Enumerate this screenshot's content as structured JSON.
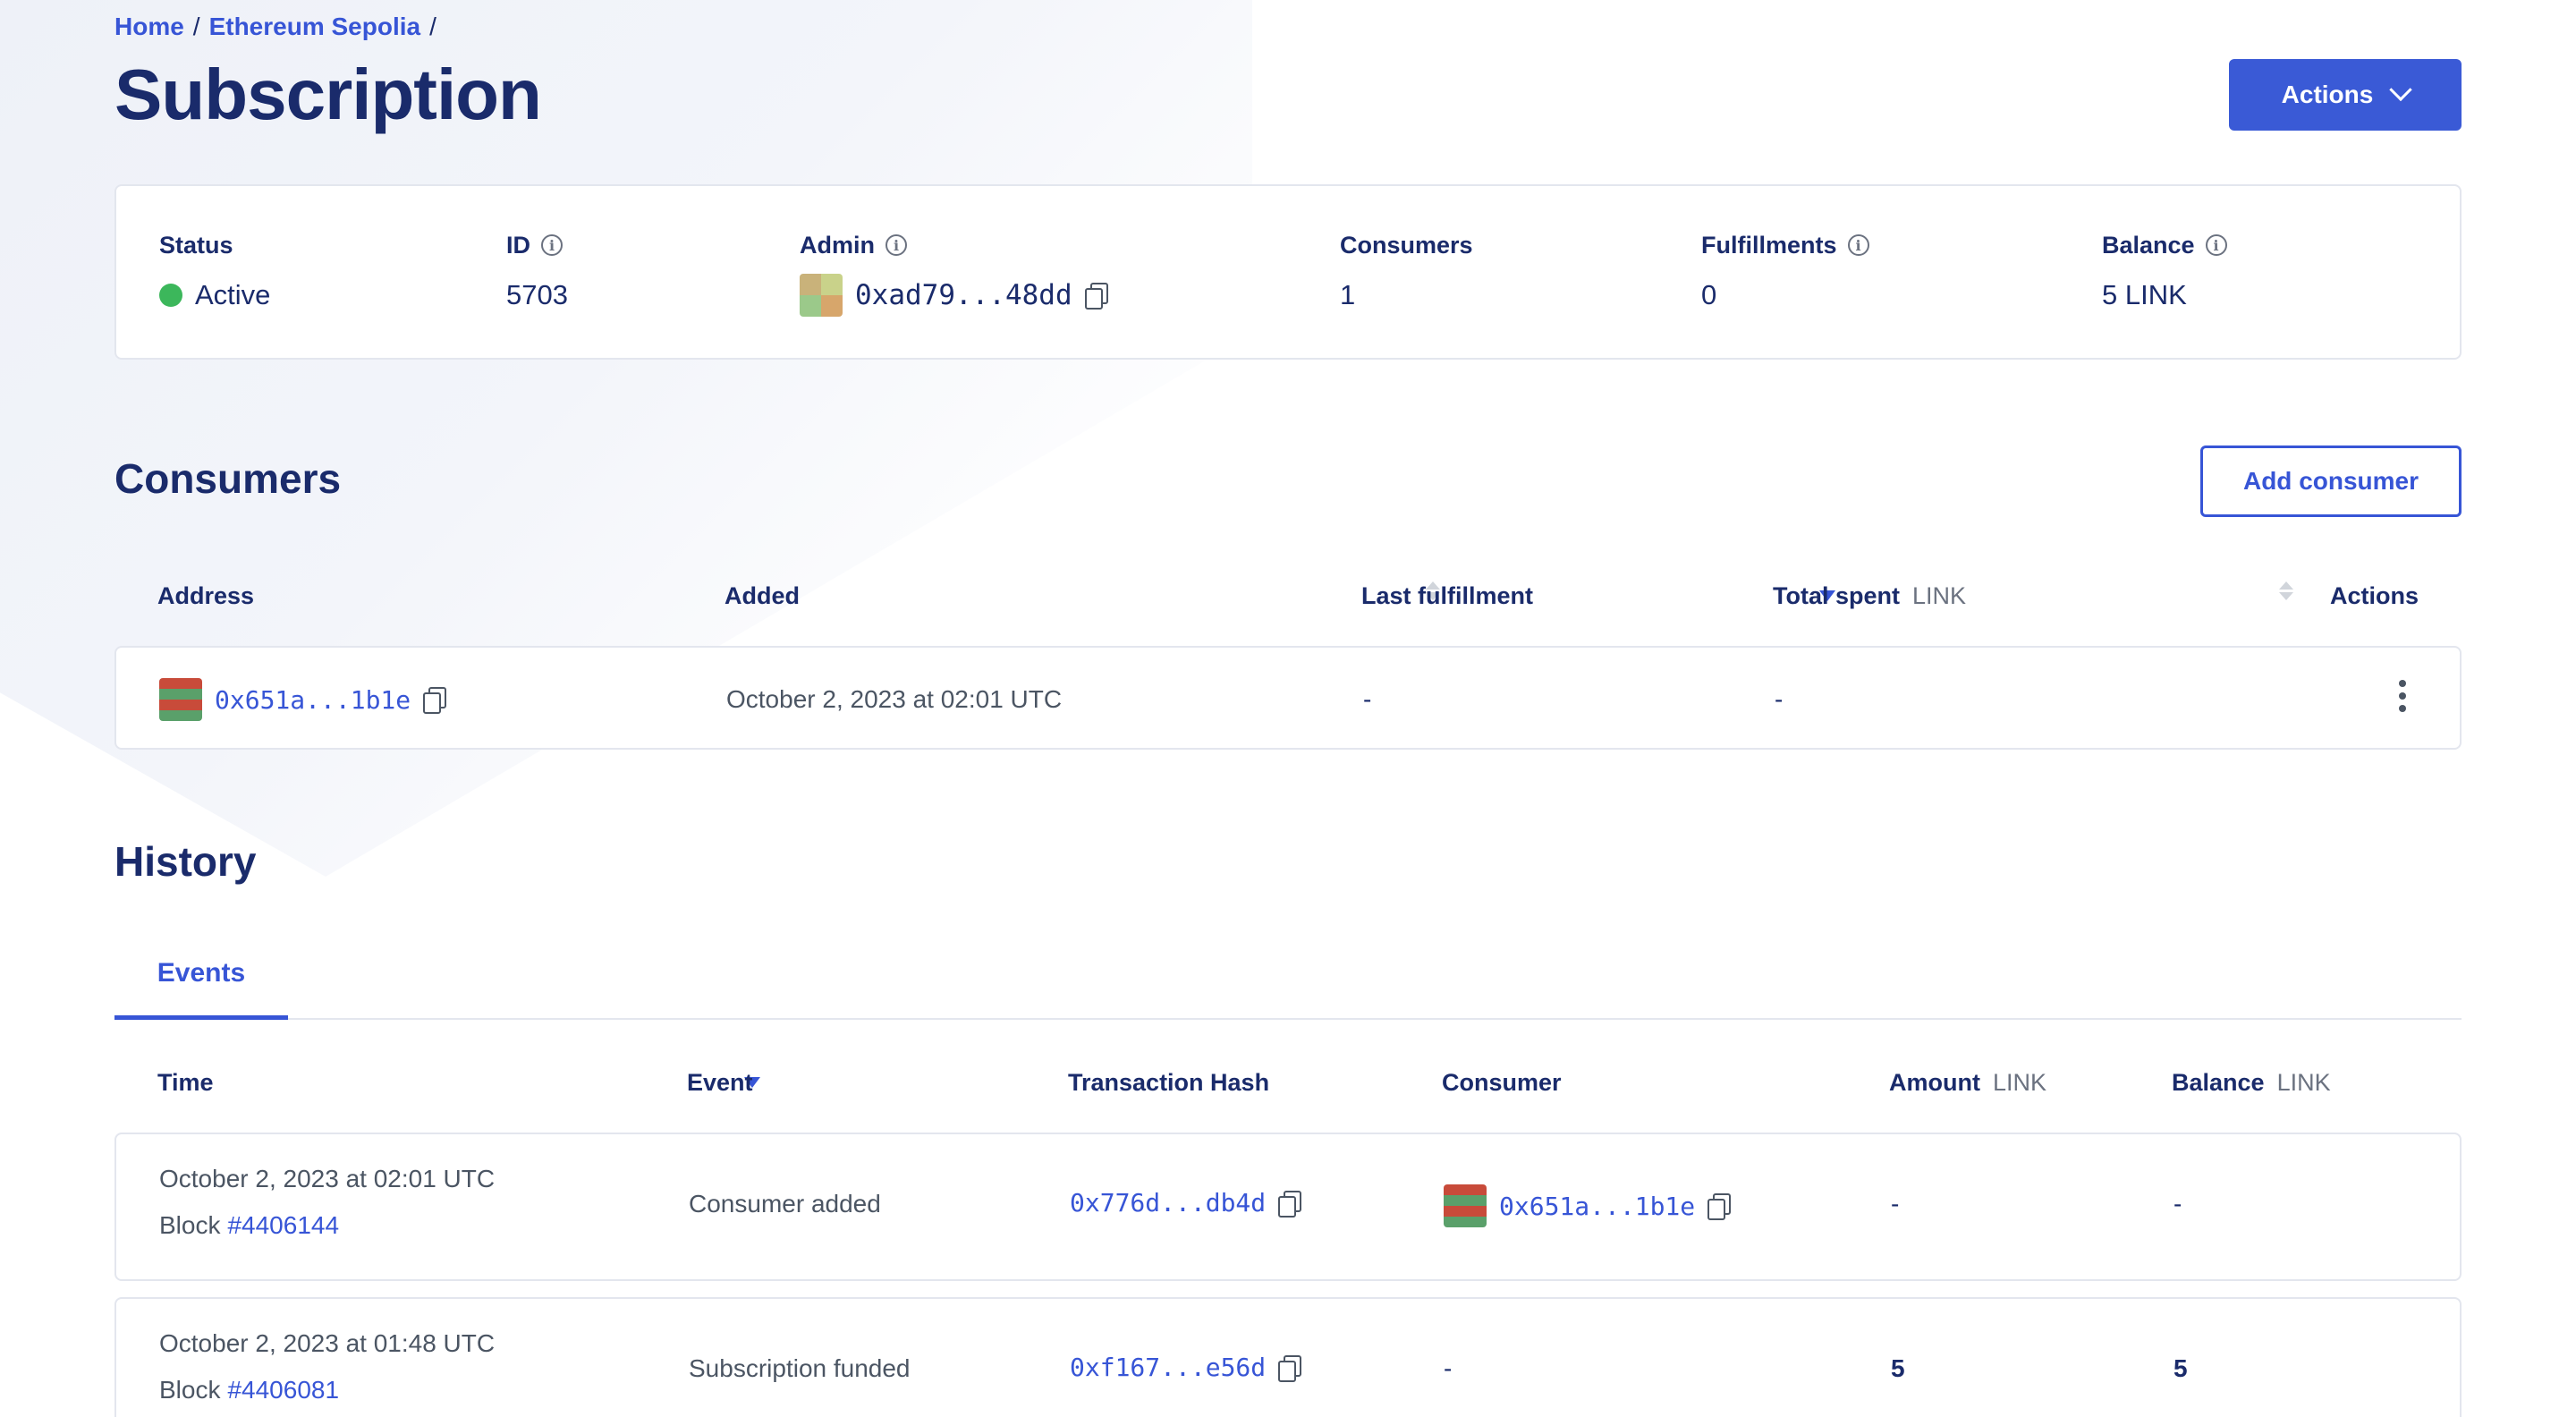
{
  "breadcrumb": {
    "home": "Home",
    "network": "Ethereum Sepolia",
    "sep": "/"
  },
  "page_title": "Subscription",
  "header_actions_label": "Actions",
  "summary": {
    "status_label": "Status",
    "status_value": "Active",
    "id_label": "ID",
    "id_value": "5703",
    "admin_label": "Admin",
    "admin_value": "0xad79...48dd",
    "consumers_label": "Consumers",
    "consumers_value": "1",
    "fulfillments_label": "Fulfillments",
    "fulfillments_value": "0",
    "balance_label": "Balance",
    "balance_value": "5 LINK",
    "info_glyph": "i"
  },
  "consumers": {
    "title": "Consumers",
    "add_button": "Add consumer",
    "columns": {
      "address": "Address",
      "added": "Added",
      "last_fulfillment": "Last fulfillment",
      "total_spent": "Total spent",
      "total_spent_unit": "LINK",
      "actions": "Actions"
    },
    "rows": [
      {
        "address": "0x651a...1b1e",
        "added": "October 2, 2023 at 02:01 UTC",
        "last_fulfillment": "-",
        "total_spent": "-"
      }
    ]
  },
  "history": {
    "title": "History",
    "tab_events": "Events",
    "columns": {
      "time": "Time",
      "event": "Event",
      "tx_hash": "Transaction Hash",
      "consumer": "Consumer",
      "amount": "Amount",
      "amount_unit": "LINK",
      "balance": "Balance",
      "balance_unit": "LINK"
    },
    "rows": [
      {
        "time": "October 2, 2023 at 02:01 UTC",
        "block_label": "Block",
        "block": "#4406144",
        "event": "Consumer added",
        "tx": "0x776d...db4d",
        "consumer": "0x651a...1b1e",
        "amount": "-",
        "balance": "-"
      },
      {
        "time": "October 2, 2023 at 01:48 UTC",
        "block_label": "Block",
        "block": "#4406081",
        "event": "Subscription funded",
        "tx": "0xf167...e56d",
        "consumer": "-",
        "amount": "5",
        "balance": "5"
      }
    ]
  },
  "colors": {
    "accent": "#3a5ad6",
    "status_active": "#3cb75b",
    "title": "#1a2b6b"
  }
}
